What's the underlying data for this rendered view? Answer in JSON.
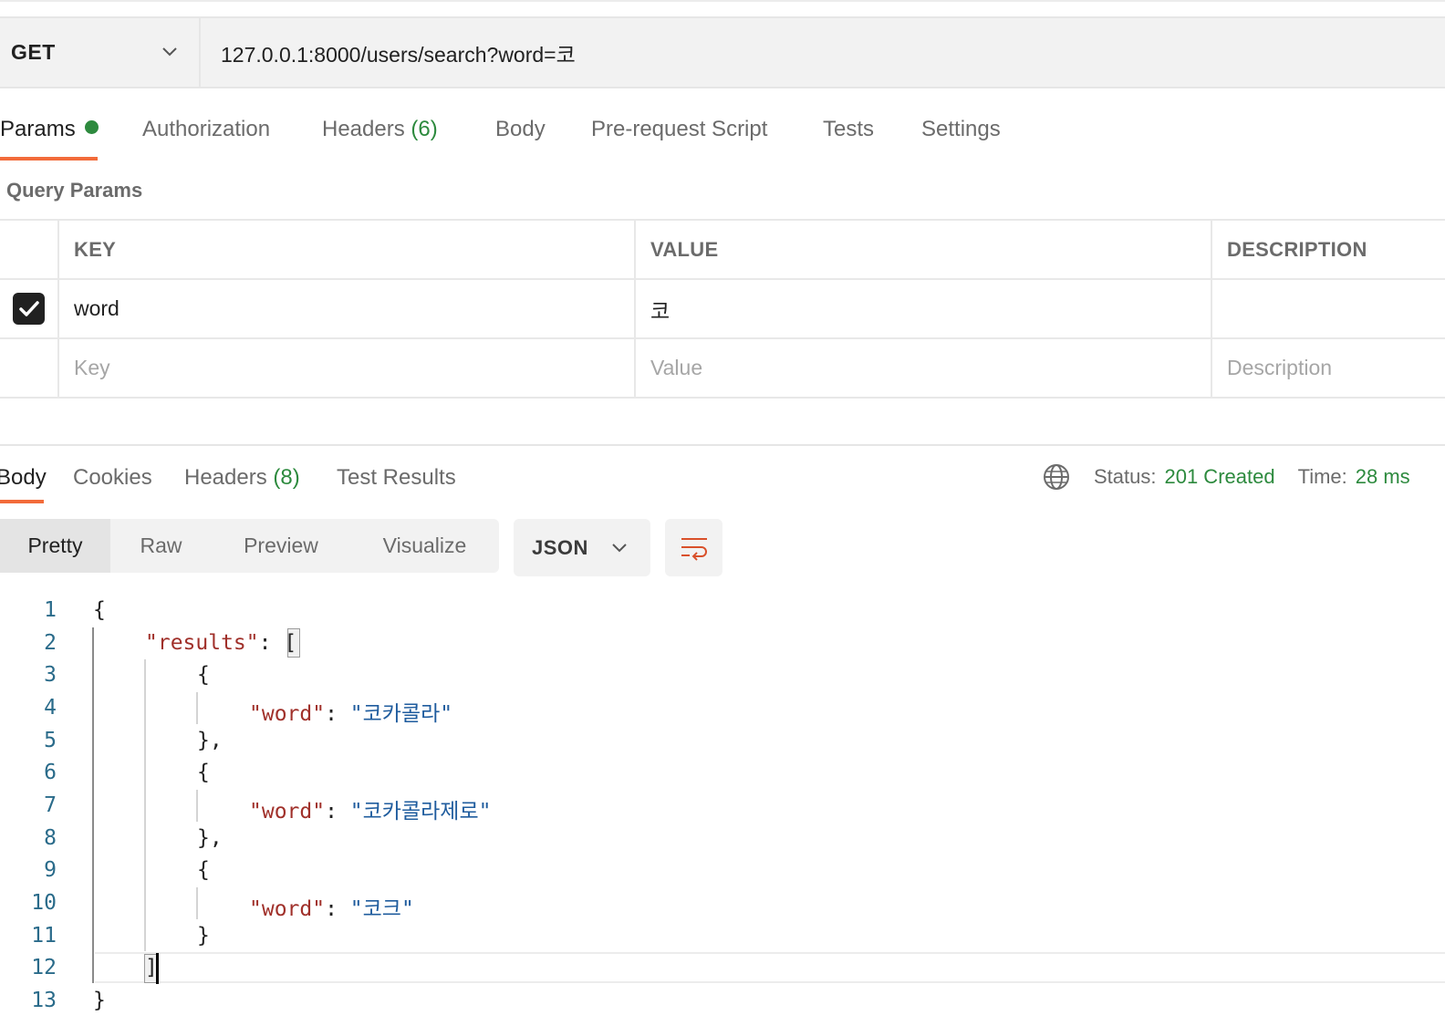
{
  "request": {
    "method": "GET",
    "url": "127.0.0.1:8000/users/search?word=코"
  },
  "request_tabs": {
    "params": "Params",
    "authorization": "Authorization",
    "headers": "Headers",
    "headers_count": "(6)",
    "body": "Body",
    "pre_request": "Pre-request Script",
    "tests": "Tests",
    "settings": "Settings"
  },
  "query_params": {
    "title": "Query Params",
    "headers": {
      "key": "KEY",
      "value": "VALUE",
      "description": "DESCRIPTION"
    },
    "rows": [
      {
        "checked": true,
        "key": "word",
        "value": "코",
        "description": ""
      }
    ],
    "placeholders": {
      "key": "Key",
      "value": "Value",
      "description": "Description"
    }
  },
  "response_tabs": {
    "body": "Body",
    "cookies": "Cookies",
    "headers": "Headers",
    "headers_count": "(8)",
    "test_results": "Test Results"
  },
  "response_meta": {
    "status_label": "Status:",
    "status_value": "201 Created",
    "time_label": "Time:",
    "time_value": "28 ms"
  },
  "view_modes": {
    "pretty": "Pretty",
    "raw": "Raw",
    "preview": "Preview",
    "visualize": "Visualize",
    "active": "Pretty"
  },
  "format": "JSON",
  "code": {
    "line_numbers": [
      "1",
      "2",
      "3",
      "4",
      "5",
      "6",
      "7",
      "8",
      "9",
      "10",
      "11",
      "12",
      "13"
    ],
    "results_key": "\"results\"",
    "word_key": "\"word\"",
    "words": [
      "\"코카콜라\"",
      "\"코카콜라제로\"",
      "\"코크\""
    ]
  },
  "colors": {
    "accent_underline": "#f26b3a",
    "status_green": "#2d8a3e",
    "json_key": "#a0302a",
    "json_string": "#1f5c9e"
  },
  "icons": [
    "chevron-down-icon",
    "checkbox-checked-icon",
    "globe-icon",
    "wrap-lines-icon"
  ]
}
